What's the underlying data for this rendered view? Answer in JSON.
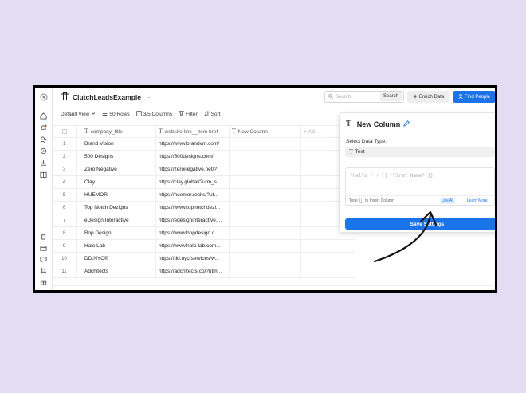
{
  "app": {
    "title": "ClutchLeadsExample",
    "more": "···"
  },
  "header": {
    "search_placeholder": "Search",
    "search_button": "Search",
    "enrich_button": "Enrich Data",
    "find_button": "Find People"
  },
  "toolbar": {
    "view": "Default View",
    "rows": "50 Rows",
    "columns": "3/5 Columns",
    "filter": "Filter",
    "sort": "Sort"
  },
  "table": {
    "columns": [
      "company_title",
      "website-link__item href",
      "New Column",
      "Ad"
    ],
    "rows": [
      {
        "n": "1",
        "company": "Brand Vision",
        "site": "https://www.brandvm.com/"
      },
      {
        "n": "2",
        "company": "500 Designs",
        "site": "https://500designs.com/"
      },
      {
        "n": "3",
        "company": "Zero Negative",
        "site": "https://zeronegative.net/?"
      },
      {
        "n": "4",
        "company": "Clay",
        "site": "https://clay.global/?utm_s..."
      },
      {
        "n": "5",
        "company": "HUEMOR",
        "site": "https://huemor.rocks/?ut..."
      },
      {
        "n": "6",
        "company": "Top Notch Dezigns",
        "site": "https://www.topnotchdezi..."
      },
      {
        "n": "7",
        "company": "eDesign Interactive",
        "site": "https://edesigninteractive...."
      },
      {
        "n": "8",
        "company": "Bop Design",
        "site": "https://www.bopdesign.c..."
      },
      {
        "n": "9",
        "company": "Halo Lab",
        "site": "https://www.halo-lab.com..."
      },
      {
        "n": "10",
        "company": "DD.NYC®",
        "site": "https://dd.nyc/services/w..."
      },
      {
        "n": "11",
        "company": "Adchitects",
        "site": "https://adchitects.co/?utm..."
      }
    ]
  },
  "panel": {
    "title": "New Column",
    "close": "×",
    "data_type_label": "Select Data Type:",
    "data_type_value": "Text",
    "formula_placeholder": "\"Hello \" + {{ \"First Name\" }}",
    "hint_prefix": "Type",
    "hint_key": "/",
    "hint_suffix": "to Insert Column",
    "use_ai": "Use AI",
    "learn_more": "Learn More",
    "save_button": "Save Settings"
  },
  "colors": {
    "accent": "#1a73e8",
    "background": "#e2ddf3"
  }
}
